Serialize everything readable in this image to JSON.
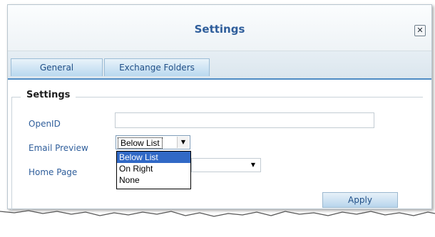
{
  "dialog": {
    "title": "Settings",
    "close_glyph": "✕"
  },
  "tabs": [
    {
      "label": "General"
    },
    {
      "label": "Exchange Folders"
    }
  ],
  "section": {
    "legend": "Settings",
    "openid": {
      "label": "OpenID",
      "value": ""
    },
    "email_preview": {
      "label": "Email Preview",
      "selected": "Below List",
      "options": [
        "Below List",
        "On Right",
        "None"
      ]
    },
    "home_page": {
      "label": "Home Page",
      "value": ""
    }
  },
  "apply_label": "Apply",
  "colors": {
    "title": "#2f5e9b",
    "label": "#2f5e9b",
    "selection": "#3169c6",
    "tab_accent": "#4f8cc4"
  },
  "icons": {
    "close": "close-icon",
    "dropdown_arrow": "chevron-down-icon"
  }
}
